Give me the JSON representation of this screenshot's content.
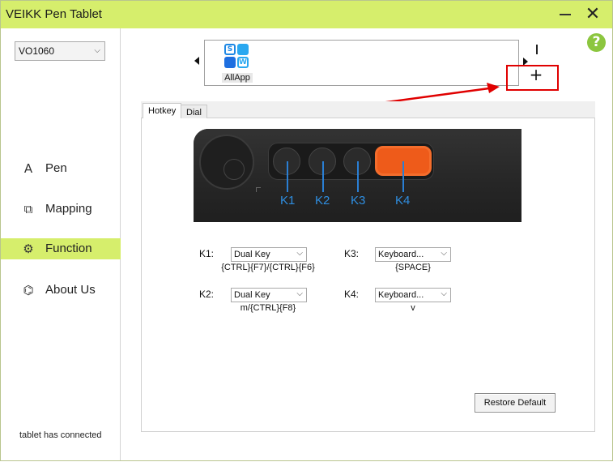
{
  "window": {
    "title": "VEIKK Pen Tablet",
    "accent_color": "#d6ee6c",
    "close_glyph": "✕"
  },
  "sidebar": {
    "device_select": {
      "value": "VO1060"
    },
    "items": [
      {
        "label": "Pen",
        "icon": "pen-icon",
        "glyph": "A",
        "active": false
      },
      {
        "label": "Mapping",
        "icon": "mapping-icon",
        "glyph": "⧉",
        "active": false
      },
      {
        "label": "Function",
        "icon": "gear-icon",
        "glyph": "⚙",
        "active": true
      },
      {
        "label": "About Us",
        "icon": "about-icon",
        "glyph": "⌬",
        "active": false
      }
    ],
    "status": "tablet has connected"
  },
  "help": {
    "icon": "help-icon",
    "glyph": "?"
  },
  "app_strip": {
    "apps": [
      {
        "label": "AllApp",
        "logo_letters": [
          "S",
          "W"
        ]
      }
    ],
    "add_glyph": "+"
  },
  "tabs": [
    {
      "label": "Hotkey",
      "active": true
    },
    {
      "label": "Dial",
      "active": false
    }
  ],
  "tablet_image": {
    "key_labels": [
      "K1",
      "K2",
      "K3",
      "K4"
    ],
    "highlight_color": "#ee5b1a"
  },
  "hotkeys": [
    {
      "key": "K1:",
      "selection": "Dual Key",
      "value": "{CTRL}{F7}/{CTRL}{F6}"
    },
    {
      "key": "K2:",
      "selection": "Dual Key",
      "value": "m/{CTRL}{F8}"
    },
    {
      "key": "K3:",
      "selection": "Keyboard...",
      "value": "{SPACE}"
    },
    {
      "key": "K4:",
      "selection": "Keyboard...",
      "value": "v"
    }
  ],
  "restore_button": {
    "label": "Restore Default"
  },
  "annotation": {
    "color": "#e00000"
  }
}
